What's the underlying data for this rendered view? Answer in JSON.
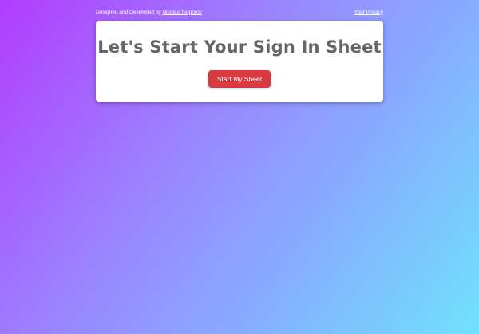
{
  "header": {
    "credit_prefix": "Designed and Developed by",
    "author_link": "Nicolas Tsoporov",
    "privacy_link": "Your Privacy"
  },
  "hero": {
    "title": "Let's Start Your Sign In Sheet",
    "button_label": "Start My Sheet"
  },
  "colors": {
    "gradient_start": "#b23cff",
    "gradient_end": "#70e2fc",
    "button": "#d93a3f",
    "title_text": "#666666"
  }
}
